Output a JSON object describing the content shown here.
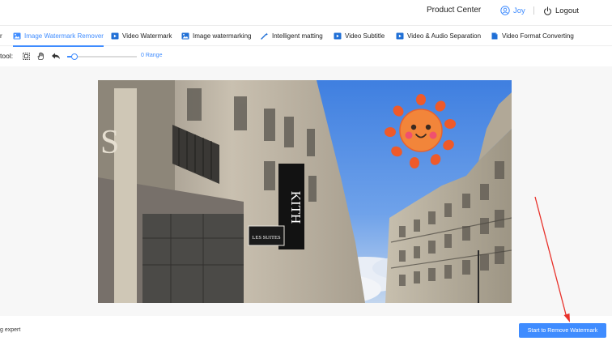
{
  "header": {
    "product_center": "Product Center",
    "user_name": "Joy",
    "logout": "Logout"
  },
  "tabs": {
    "partial_left": "r",
    "items": [
      {
        "label": "Image Watermark Remover",
        "active": true,
        "icon": "image-icon"
      },
      {
        "label": "Video Watermark",
        "active": false,
        "icon": "video-icon"
      },
      {
        "label": "Image watermarking",
        "active": false,
        "icon": "image-icon"
      },
      {
        "label": "Intelligent matting",
        "active": false,
        "icon": "magic-wand-icon"
      },
      {
        "label": "Video Subtitle",
        "active": false,
        "icon": "video-icon"
      },
      {
        "label": "Video & Audio Separation",
        "active": false,
        "icon": "video-icon"
      },
      {
        "label": "Video Format Converting",
        "active": false,
        "icon": "file-icon"
      }
    ]
  },
  "toolbar": {
    "label": "tool:",
    "tools": [
      "select-box-icon",
      "hand-icon",
      "undo-icon"
    ],
    "brush_value": 0.1,
    "range_label": "0 Range"
  },
  "canvas": {
    "sign_kith": "KITH",
    "sign_les_suites": "LES SUITES"
  },
  "footer": {
    "left_text": "g expert",
    "start_button": "Start to Remove Watermark"
  },
  "colors": {
    "accent": "#3f8cff",
    "arrow": "#e8322b"
  }
}
